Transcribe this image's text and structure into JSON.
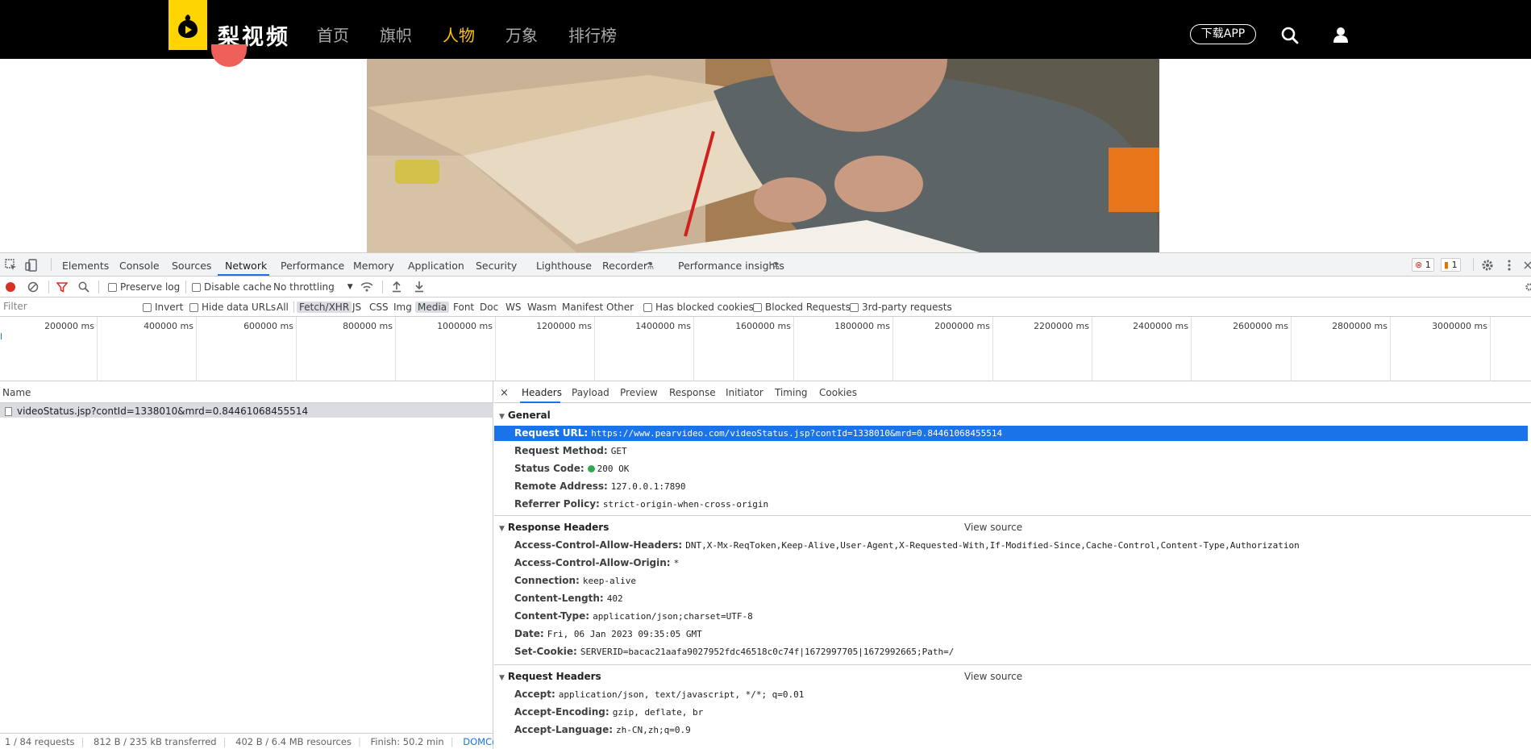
{
  "site": {
    "logo_text": "梨视频",
    "nav": [
      "首页",
      "旗帜",
      "人物",
      "万象",
      "排行榜"
    ],
    "active_nav_index": 2,
    "download_label": "下载APP",
    "accent_color": "#ffc400",
    "logo_color": "#ffd500"
  },
  "devtools": {
    "tabs": [
      "Elements",
      "Console",
      "Sources",
      "Network",
      "Performance",
      "Memory",
      "Application",
      "Security",
      "Lighthouse",
      "Recorder",
      "Performance insights"
    ],
    "active_tab": "Network",
    "error_count": "1",
    "warning_count": "1",
    "toolbar": {
      "preserve_log": "Preserve log",
      "disable_cache": "Disable cache",
      "throttling": "No throttling"
    },
    "filter": {
      "placeholder": "Filter",
      "invert": "Invert",
      "hide_data_urls": "Hide data URLs",
      "types": [
        "All",
        "Fetch/XHR",
        "JS",
        "CSS",
        "Img",
        "Media",
        "Font",
        "Doc",
        "WS",
        "Wasm",
        "Manifest",
        "Other"
      ],
      "has_blocked_cookies": "Has blocked cookies",
      "blocked_requests": "Blocked Requests",
      "third_party": "3rd-party requests"
    },
    "timeline_ticks": [
      "200000 ms",
      "400000 ms",
      "600000 ms",
      "800000 ms",
      "1000000 ms",
      "1200000 ms",
      "1400000 ms",
      "1600000 ms",
      "1800000 ms",
      "2000000 ms",
      "2200000 ms",
      "2400000 ms",
      "2600000 ms",
      "2800000 ms",
      "3000000 ms"
    ],
    "request_list": {
      "column_name": "Name",
      "rows": [
        "videoStatus.jsp?contId=1338010&mrd=0.84461068455514"
      ]
    },
    "status_bar": {
      "requests": "1 / 84 requests",
      "transferred": "812 B / 235 kB transferred",
      "resources": "402 B / 6.4 MB resources",
      "finish": "Finish: 50.2 min",
      "dom": "DOMContentLoad"
    },
    "detail": {
      "close": "×",
      "tabs": [
        "Headers",
        "Payload",
        "Preview",
        "Response",
        "Initiator",
        "Timing",
        "Cookies"
      ],
      "active_tab": "Headers",
      "view_source": "View source",
      "general": {
        "title": "General",
        "rows": [
          {
            "k": "Request URL:",
            "v": "https://www.pearvideo.com/videoStatus.jsp?contId=1338010&mrd=0.84461068455514"
          },
          {
            "k": "Request Method:",
            "v": "GET"
          },
          {
            "k": "Status Code:",
            "v": "200 OK"
          },
          {
            "k": "Remote Address:",
            "v": "127.0.0.1:7890"
          },
          {
            "k": "Referrer Policy:",
            "v": "strict-origin-when-cross-origin"
          }
        ]
      },
      "response_headers": {
        "title": "Response Headers",
        "rows": [
          {
            "k": "Access-Control-Allow-Headers:",
            "v": "DNT,X-Mx-ReqToken,Keep-Alive,User-Agent,X-Requested-With,If-Modified-Since,Cache-Control,Content-Type,Authorization"
          },
          {
            "k": "Access-Control-Allow-Origin:",
            "v": "*"
          },
          {
            "k": "Connection:",
            "v": "keep-alive"
          },
          {
            "k": "Content-Length:",
            "v": "402"
          },
          {
            "k": "Content-Type:",
            "v": "application/json;charset=UTF-8"
          },
          {
            "k": "Date:",
            "v": "Fri, 06 Jan 2023 09:35:05 GMT"
          },
          {
            "k": "Set-Cookie:",
            "v": "SERVERID=bacac21aafa9027952fdc46518c0c74f|1672997705|1672992665;Path=/"
          }
        ]
      },
      "request_headers": {
        "title": "Request Headers",
        "rows": [
          {
            "k": "Accept:",
            "v": "application/json, text/javascript, */*; q=0.01"
          },
          {
            "k": "Accept-Encoding:",
            "v": "gzip, deflate, br"
          },
          {
            "k": "Accept-Language:",
            "v": "zh-CN,zh;q=0.9"
          }
        ]
      }
    }
  }
}
